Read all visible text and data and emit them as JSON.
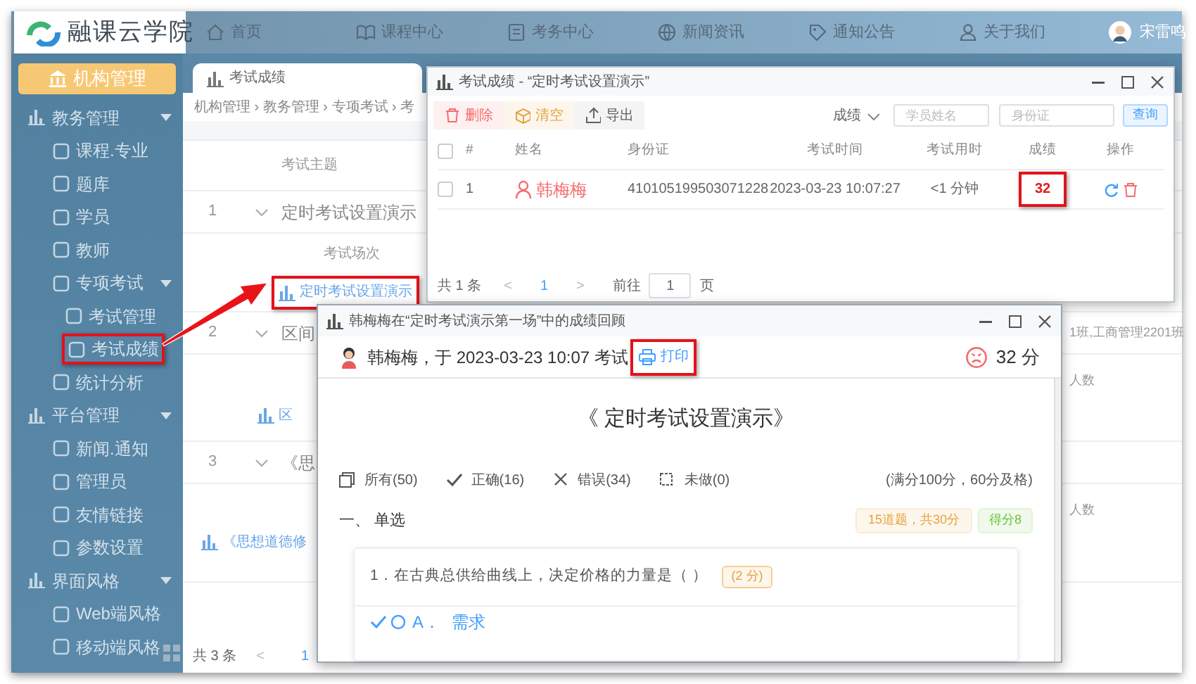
{
  "top_bar": {
    "logo": "融课云学院",
    "nav": [
      {
        "label": "首页"
      },
      {
        "label": "课程中心"
      },
      {
        "label": "考务中心"
      },
      {
        "label": "新闻资讯"
      },
      {
        "label": "通知公告"
      },
      {
        "label": "关于我们"
      }
    ],
    "user": "宋雷鸣"
  },
  "sidebar": {
    "header": "机构管理",
    "items": [
      {
        "label": "教务管理",
        "expanded": true,
        "children": [
          {
            "label": "课程.专业",
            "highlighted": false
          },
          {
            "label": "题库",
            "highlighted": false
          },
          {
            "label": "学员",
            "highlighted": false
          },
          {
            "label": "教师",
            "highlighted": false
          },
          {
            "label": "专项考试",
            "expanded": true,
            "children": [
              {
                "label": "考试管理",
                "highlighted": false
              },
              {
                "label": "考试成绩",
                "highlighted": true
              }
            ]
          },
          {
            "label": "统计分析",
            "highlighted": false
          }
        ]
      },
      {
        "label": "平台管理",
        "expanded": true,
        "children": [
          {
            "label": "新闻.通知",
            "highlighted": false
          },
          {
            "label": "管理员",
            "highlighted": false
          },
          {
            "label": "友情链接",
            "highlighted": false
          },
          {
            "label": "参数设置",
            "highlighted": false
          }
        ]
      },
      {
        "label": "界面风格",
        "expanded": true,
        "children": [
          {
            "label": "Web端风格",
            "highlighted": false
          },
          {
            "label": "移动端风格",
            "highlighted": false
          }
        ]
      }
    ]
  },
  "main": {
    "tab": "考试成绩",
    "breadcrumb": "机构管理 › 教务管理 › 专项考试 › 考",
    "table": {
      "header": "考试主题",
      "rows": [
        {
          "index": "1",
          "topic": "定时考试设置演示",
          "sub_header": "考试场次",
          "session_link": "定时考试设置演示",
          "highlighted": true
        },
        {
          "index": "2",
          "topic": "区间",
          "classes": "1班,工商管理2201班",
          "count_label": "人数",
          "session_link": "区",
          "highlighted": false
        },
        {
          "index": "3",
          "topic": "《思",
          "count_label": "人数",
          "session_link": "《思想道德修",
          "highlighted": false
        }
      ]
    },
    "footer": {
      "total": "共 3 条",
      "prev": "<",
      "page": "1"
    }
  },
  "results_dialog": {
    "title": "考试成绩 - “定时考试设置演示”",
    "toolbar": [
      {
        "label": "删除",
        "kind": "danger"
      },
      {
        "label": "清空",
        "kind": "warning"
      },
      {
        "label": "导出",
        "kind": "plain"
      }
    ],
    "filter": {
      "select": "成绩",
      "name_placeholder": "学员姓名",
      "id_placeholder": "身份证",
      "search": "查询"
    },
    "columns": [
      "#",
      "姓名",
      "身份证",
      "考试时间",
      "考试用时",
      "成绩",
      "操作"
    ],
    "rows": [
      {
        "checked": false,
        "index": "1",
        "name": "韩梅梅",
        "id_number": "410105199503071228",
        "time": "2023-03-23 10:07:27",
        "duration": "<1 分钟",
        "score": "32",
        "highlighted": true
      }
    ],
    "pager": {
      "total": "共 1 条",
      "prev": "<",
      "page": "1",
      "next": ">",
      "goto": "前往",
      "goto_value": "1",
      "unit": "页"
    }
  },
  "review_dialog": {
    "title": "韩梅梅在“定时考试演示第一场”中的成绩回顾",
    "summary": "韩梅梅，于 2023-03-23 10:07 考试",
    "print": {
      "label": "打印",
      "highlighted": true
    },
    "score": "32 分",
    "paper_title": "《 定时考试设置演示》",
    "filters": [
      {
        "label": "所有(50)",
        "kind": "all"
      },
      {
        "label": "正确(16)",
        "kind": "correct"
      },
      {
        "label": "错误(34)",
        "kind": "wrong"
      },
      {
        "label": "未做(0)",
        "kind": "unanswered"
      }
    ],
    "rule": "(满分100分，60分及格)",
    "section": {
      "title": "一、 单选",
      "count_badge": "15道题，共30分",
      "score_badge": "得分8"
    },
    "question": {
      "text": "1．在古典总供给曲线上，决定价格的力量是（ ）",
      "points": "(2 分)",
      "options": [
        {
          "label": "A．",
          "text": "需求",
          "correct": true
        }
      ]
    }
  }
}
